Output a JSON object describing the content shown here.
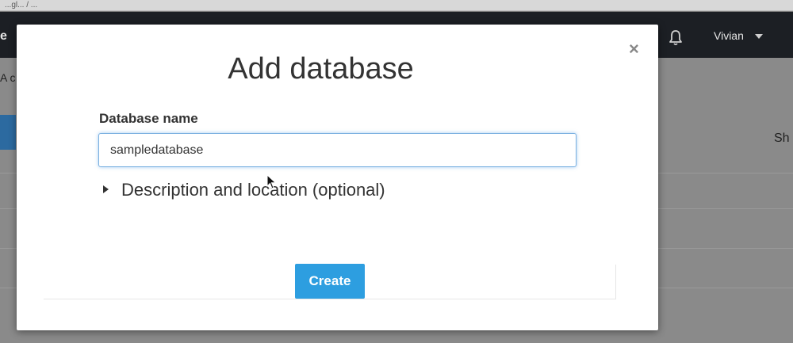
{
  "browser": {
    "url_fragment": "...gl... / ..."
  },
  "navbar": {
    "left_text": "e",
    "user_name": "Vivian"
  },
  "background": {
    "text_fragment": "A c",
    "right_text": "Sh"
  },
  "modal": {
    "title": "Add database",
    "close_glyph": "×",
    "field_label": "Database name",
    "database_name_value": "sampledatabase",
    "disclosure_label": "Description and location (optional)",
    "create_label": "Create"
  },
  "colors": {
    "primary_button": "#2d9ee0",
    "input_focus": "#7ab0e0",
    "navbar": "#1c1f24"
  },
  "icons": [
    "bell-icon",
    "close-icon",
    "caret-down-icon",
    "disclosure-triangle-icon",
    "mouse-cursor-icon"
  ]
}
